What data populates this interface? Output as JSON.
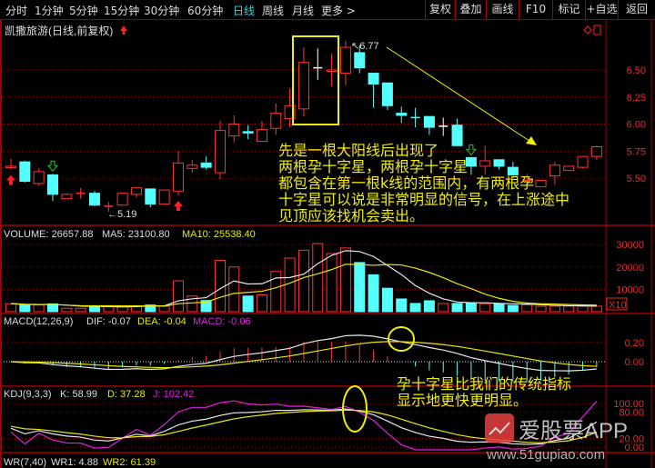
{
  "toolbar": {
    "periods": [
      "分时",
      "1分钟",
      "5分钟",
      "15分钟",
      "30分钟",
      "60分钟",
      "日线",
      "周线",
      "月线",
      "更多 >"
    ],
    "active_period": "日线",
    "buttons": [
      "复权",
      "叠加",
      "画线",
      "F10",
      "标记",
      "+自选",
      "返回"
    ]
  },
  "main": {
    "title": "凯撒旅游(日线,前复权)",
    "high_label": "6.77",
    "low_label": "5.19"
  },
  "annotations": {
    "text1": [
      "先是一根大阳线后出现了",
      "两根孕十字星，两根孕十字星",
      "都包含在第一根k线的范围内，有两根孕",
      "十字星可以说是非常明显的信号，在上涨途中",
      "见顶应该找机会卖出。"
    ],
    "text2": [
      "孕十字星比我们的传统指标",
      "显示地更快更明显。"
    ]
  },
  "volume": {
    "label": "VOLUME: 26657.88",
    "ma5": "MA5: 23100.80",
    "ma10": "MA10: 25538.40",
    "unit": "X10"
  },
  "macd": {
    "label": "MACD(12,26,9)",
    "dif": "DIF: -0.07",
    "dea": "DEA: -0.04",
    "macd": "MACD: -0.06"
  },
  "kdj": {
    "label": "KDJ(9,3,3)",
    "k": "K: 58.99",
    "d": "D: 37.28",
    "j": "J: 102.42"
  },
  "wr": {
    "label": "WR(7,40)",
    "wr1": "WR1: 4.88",
    "wr2": "WR2: 61.39"
  },
  "watermark": {
    "brand": "爱股票APP",
    "url": "www.51gupiao.com"
  },
  "colors": {
    "up": "#ff3232",
    "down": "#54ffff",
    "grid": "#a00000",
    "ann": "#f0f000",
    "ma_white": "#e8e8e8",
    "ma_yellow": "#e8e800",
    "j": "#e020e0"
  },
  "chart_data": {
    "type": "candlestick",
    "title": "凯撒旅游(日线,前复权)",
    "price_axis": {
      "ticks": [
        "6.50",
        "6.25",
        "6.00",
        "5.75",
        "5.50"
      ],
      "range": [
        5.1,
        6.9
      ]
    },
    "volume_axis": {
      "ticks": [
        "30000",
        "20000",
        "10000"
      ]
    },
    "macd_axis": {
      "ticks": [
        "0.20",
        "0.00"
      ]
    },
    "kdj_axis": {
      "ticks": [
        "100.00",
        "80.00",
        "20.00",
        "0.00"
      ]
    },
    "ohlc": [
      [
        5.6,
        5.68,
        5.58,
        5.61
      ],
      [
        5.65,
        5.66,
        5.46,
        5.47
      ],
      [
        5.45,
        5.59,
        5.43,
        5.56
      ],
      [
        5.53,
        5.54,
        5.29,
        5.35
      ],
      [
        5.31,
        5.36,
        5.31,
        5.35
      ],
      [
        5.36,
        5.41,
        5.31,
        5.36
      ],
      [
        5.36,
        5.38,
        5.24,
        5.25
      ],
      [
        5.24,
        5.28,
        5.19,
        5.24
      ],
      [
        5.25,
        5.36,
        5.25,
        5.36
      ],
      [
        5.35,
        5.41,
        5.32,
        5.41
      ],
      [
        5.4,
        5.4,
        5.23,
        5.26
      ],
      [
        5.26,
        5.39,
        5.26,
        5.39
      ],
      [
        5.38,
        5.75,
        5.34,
        5.64
      ],
      [
        5.59,
        5.67,
        5.55,
        5.62
      ],
      [
        5.64,
        5.7,
        5.58,
        5.6
      ],
      [
        5.55,
        6.03,
        5.49,
        5.94
      ],
      [
        5.89,
        6.08,
        5.83,
        6.0
      ],
      [
        5.93,
        5.99,
        5.86,
        5.92
      ],
      [
        5.84,
        6.03,
        5.84,
        5.95
      ],
      [
        5.96,
        6.19,
        5.9,
        6.1
      ],
      [
        6.05,
        6.33,
        5.97,
        6.17
      ],
      [
        6.14,
        6.71,
        6.07,
        6.57
      ],
      [
        6.52,
        6.7,
        6.41,
        6.52
      ],
      [
        6.49,
        6.65,
        6.35,
        6.5
      ],
      [
        6.47,
        6.77,
        6.36,
        6.71
      ],
      [
        6.66,
        6.73,
        6.47,
        6.52
      ],
      [
        6.47,
        6.47,
        6.15,
        6.37
      ],
      [
        6.38,
        6.38,
        6.13,
        6.17
      ],
      [
        6.1,
        6.16,
        6.01,
        6.08
      ],
      [
        6.06,
        6.15,
        5.97,
        6.06
      ],
      [
        6.07,
        6.07,
        5.9,
        5.97
      ],
      [
        5.98,
        6.06,
        5.89,
        5.98
      ],
      [
        5.99,
        6.05,
        5.8,
        5.8
      ],
      [
        5.69,
        5.69,
        5.53,
        5.61
      ],
      [
        5.61,
        5.8,
        5.53,
        5.66
      ],
      [
        5.67,
        5.67,
        5.58,
        5.61
      ],
      [
        5.6,
        5.65,
        5.53,
        5.53
      ],
      [
        5.48,
        5.54,
        5.45,
        5.48
      ],
      [
        5.42,
        5.48,
        5.42,
        5.48
      ],
      [
        5.52,
        5.65,
        5.44,
        5.62
      ],
      [
        5.57,
        5.61,
        5.57,
        5.61
      ],
      [
        5.6,
        5.7,
        5.59,
        5.7
      ],
      [
        5.7,
        5.8,
        5.67,
        5.79
      ]
    ],
    "doji_colors": {
      "17": "#54ffff",
      "22": "#ffffff",
      "29": "#54ffff",
      "31": "#ffffff"
    },
    "volume": [
      3600,
      3000,
      3000,
      3500,
      1500,
      1500,
      2500,
      2500,
      2500,
      2500,
      3000,
      2500,
      13800,
      7000,
      5000,
      23000,
      20000,
      7000,
      7500,
      18000,
      24000,
      27500,
      30500,
      26000,
      28500,
      22000,
      16500,
      10500,
      5700,
      3700,
      4900,
      3700,
      3700,
      4000,
      3600,
      3600,
      2800,
      3100,
      2400,
      2500,
      2500,
      2500,
      2500
    ],
    "signals": {
      "buy_up_arrows": [
        0,
        12
      ],
      "sell_down_arrows": [
        3,
        33
      ]
    }
  }
}
